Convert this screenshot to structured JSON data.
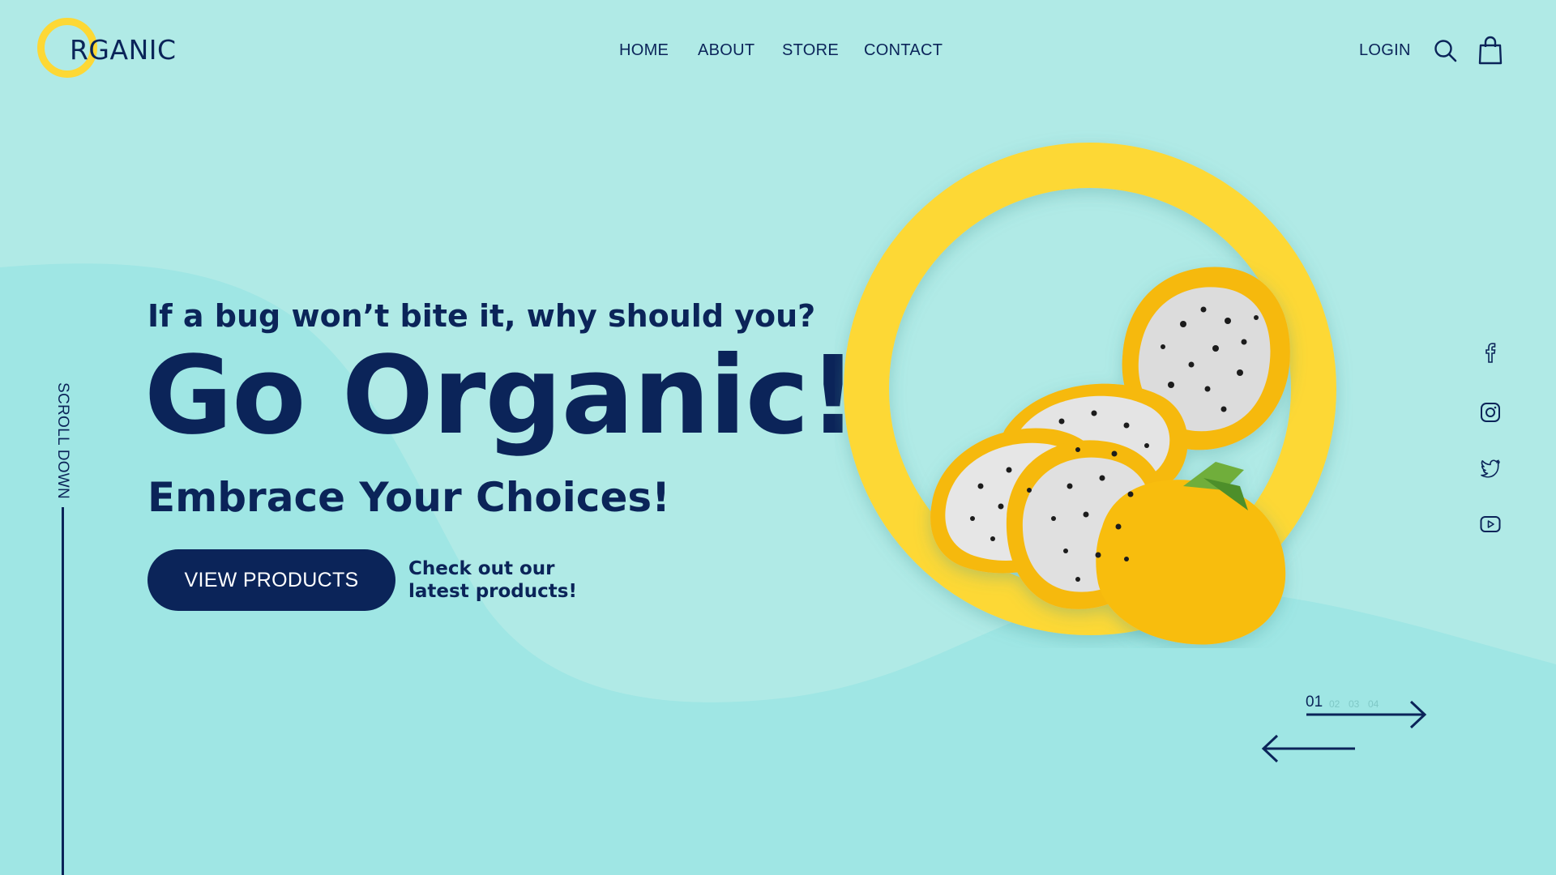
{
  "brand": {
    "logo_text": "RGANIC",
    "accent": "#fdd835",
    "navy": "#0b2459",
    "background": "#b0eae6"
  },
  "nav": {
    "items": [
      "HOME",
      "ABOUT",
      "STORE",
      "CONTACT"
    ]
  },
  "header": {
    "login_label": "LOGIN",
    "search_icon": "search-icon",
    "cart_icon": "shopping-bag-icon"
  },
  "hero": {
    "tagline": "If a bug won’t bite it, why should you?",
    "headline": "Go Organic!",
    "subhead": "Embrace Your Choices!",
    "cta_label": "VIEW PRODUCTS",
    "cta_note": "Check out our latest products!",
    "image_subject": "sliced yellow dragon fruit inside a yellow ring"
  },
  "scroll": {
    "label": "SCROLL DOWN"
  },
  "social": [
    "facebook-icon",
    "instagram-icon",
    "twitter-icon",
    "youtube-icon"
  ],
  "slider": {
    "current": "01",
    "others": [
      "02",
      "03",
      "04"
    ],
    "total": 4
  }
}
